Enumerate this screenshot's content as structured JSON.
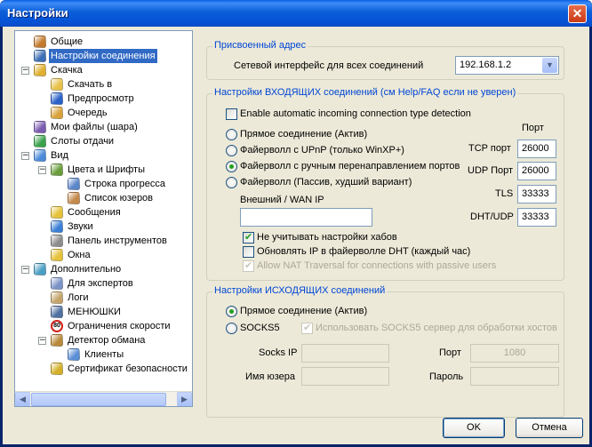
{
  "window": {
    "title": "Настройки",
    "close_glyph": "✕"
  },
  "tree": {
    "items": [
      {
        "label": "Общие",
        "icon": "people-icon"
      },
      {
        "label": "Настройки соединения",
        "icon": "network-icon"
      },
      {
        "label": "Скачка",
        "icon": "download-icon"
      },
      {
        "label": "Скачать в",
        "icon": "folder-icon"
      },
      {
        "label": "Предпросмотр",
        "icon": "play-icon"
      },
      {
        "label": "Очередь",
        "icon": "queue-icon"
      },
      {
        "label": "Мои файлы (шара)",
        "icon": "share-icon"
      },
      {
        "label": "Слоты отдачи",
        "icon": "upload-icon"
      },
      {
        "label": "Вид",
        "icon": "view-icon"
      },
      {
        "label": "Цвета и Шрифты",
        "icon": "colors-icon"
      },
      {
        "label": "Строка прогресса",
        "icon": "progress-icon"
      },
      {
        "label": "Список юзеров",
        "icon": "user-icon"
      },
      {
        "label": "Сообщения",
        "icon": "message-icon"
      },
      {
        "label": "Звуки",
        "icon": "sound-icon"
      },
      {
        "label": "Панель инструментов",
        "icon": "toolbar-icon"
      },
      {
        "label": "Окна",
        "icon": "windows-icon"
      },
      {
        "label": "Дополнительно",
        "icon": "advanced-icon"
      },
      {
        "label": "Для экспертов",
        "icon": "expert-icon"
      },
      {
        "label": "Логи",
        "icon": "log-icon"
      },
      {
        "label": "МЕНЮШКИ",
        "icon": "menu-icon"
      },
      {
        "label": "Ограничения скорости",
        "icon": "speed-limit-icon"
      },
      {
        "label": "Детектор обмана",
        "icon": "lock-icon"
      },
      {
        "label": "Клиенты",
        "icon": "clients-icon"
      },
      {
        "label": "Сертификат безопасности",
        "icon": "certificate-icon"
      }
    ],
    "selected_index": 1,
    "speed_sign": "80"
  },
  "assigned": {
    "title": "Присвоенный адрес",
    "iface_label": "Сетевой интерфейс для всех соединений",
    "iface_value": "192.168.1.2"
  },
  "incoming": {
    "title": "Настройки ВХОДЯЩИХ соединений (см Help/FAQ если не уверен)",
    "auto_detect": "Enable automatic incoming connection type detection",
    "port_header": "Порт",
    "options": [
      "Прямое соединение (Актив)",
      "Файерволл с UPnP (только WinXP+)",
      "Файерволл с ручным перенаправлением портов",
      "Файерволл (Пассив, худший вариант)"
    ],
    "selected_option": 2,
    "wan_label": "Внешний / WAN IP",
    "wan_value": "",
    "tcp_label": "TCP порт",
    "tcp_value": "26000",
    "udp_label": "UDP Порт",
    "udp_value": "26000",
    "tls_label": "TLS",
    "tls_value": "33333",
    "dht_label": "DHT/UDP",
    "dht_value": "33333",
    "ignore_hubs": "Не учитывать настройки хабов",
    "update_ip": "Обновлять IP в файерволле DHT (каждый час)",
    "nat_traversal": "Allow NAT Traversal for connections with passive users"
  },
  "outgoing": {
    "title": "Настройки ИСХОДЯЩИХ соединений",
    "direct": "Прямое соединение (Актив)",
    "socks5": "SOCKS5",
    "use_socks_hosts": "Использовать SOCKS5 сервер для обработки хостов",
    "socks_ip_label": "Socks IP",
    "port_label": "Порт",
    "port_value": "1080",
    "user_label": "Имя юзера",
    "password_label": "Пароль"
  },
  "buttons": {
    "ok": "OK",
    "cancel": "Отмена"
  }
}
